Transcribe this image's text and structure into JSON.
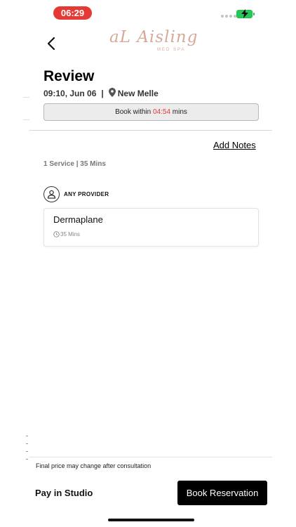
{
  "status_bar": {
    "time": "06:29",
    "time_pill_color": "#e53935",
    "battery_color": "#29c75a"
  },
  "header": {
    "back_icon": "chevron-left-icon",
    "logo_text": "Aisling",
    "logo_monogram": "aL",
    "logo_subtext": "MED SPA"
  },
  "review": {
    "title": "Review",
    "datetime": "09:10, Jun 06",
    "separator": "|",
    "location": "New Melle",
    "location_icon": "map-pin-icon",
    "book_within_prefix": "Book within",
    "timer": "04:54",
    "book_within_suffix": "mins",
    "timer_color": "#e53935"
  },
  "notes": {
    "add_notes_label": "Add Notes"
  },
  "summary": {
    "text": "1 Service | 35 Mins"
  },
  "provider": {
    "icon": "person-icon",
    "label": "ANY PROVIDER"
  },
  "service": {
    "name": "Dermaplane",
    "duration": "35 Mins",
    "duration_icon": "clock-icon"
  },
  "footer": {
    "final_price_note": "Final price may change after consultation",
    "pay_label": "Pay in Studio",
    "book_label": "Book Reservation",
    "book_button_color": "#000000"
  }
}
